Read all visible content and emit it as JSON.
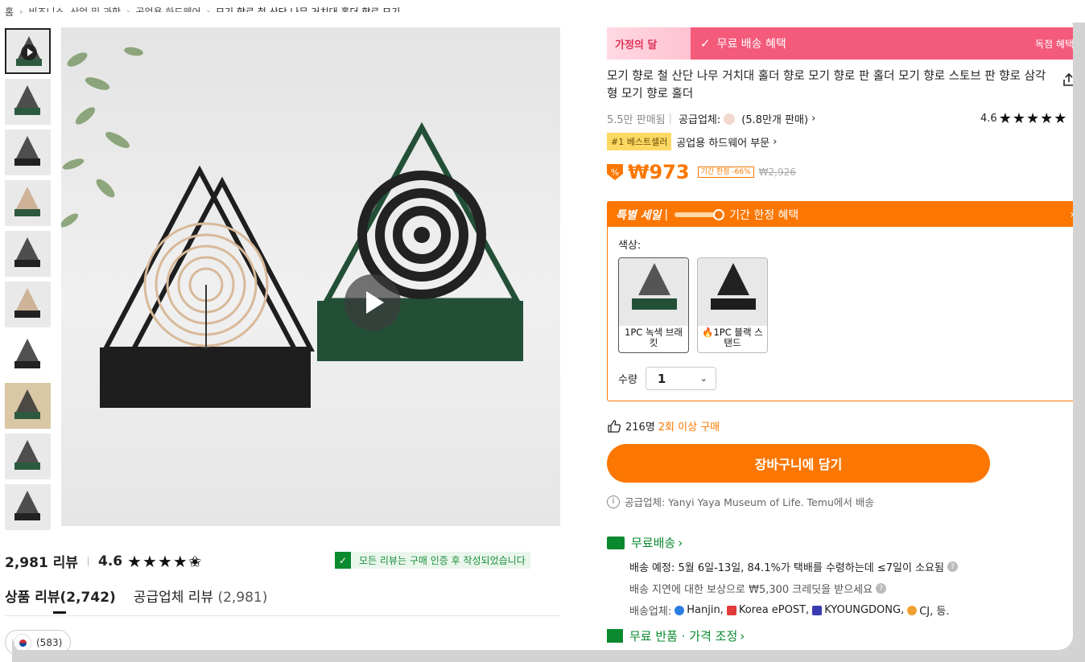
{
  "breadcrumb": {
    "items": [
      "홈",
      "비즈니스, 산업 및 과학",
      "공업용 하드웨어"
    ],
    "current": "모기 향로 철 산단 나무 거치대 홀더 향로 모기..."
  },
  "gallery": {
    "thumbnail_count": 10
  },
  "reviews": {
    "count": "2,981 리뷰",
    "rating": "4.6",
    "stars": "★★★★✬",
    "verified_text": "모든 리뷰는 구매 인증 후 작성되었습니다",
    "tabs": [
      {
        "label": "상품 리뷰",
        "count": "(2,742)"
      },
      {
        "label": "공급업체 리뷰",
        "count": "(2,981)"
      }
    ],
    "country_count": "(583)"
  },
  "promo": {
    "festival": "가정의 달",
    "label": "무료 배송 혜택",
    "right_label": "독점 혜택",
    "color": "#f45a7a"
  },
  "product": {
    "title": "모기 향로 철 산단 나무 거치대 홀더 향로 모기 향로 판 홀더 모기 향로 스토브 판 향로 삼각형 모기 향로 홀더",
    "sold": "5.5만 판매됨",
    "supplier_label": "공급업체:",
    "supplier_sales": "(5.8만개 판매)",
    "rating": "4.6",
    "rating_stars": "★★★★★",
    "best_badge": "#1 베스트셀러",
    "best_category": "공업용 하드웨어 부문",
    "price": "₩973",
    "limited_tag": "기간 한정 -66%",
    "original_price": "₩2,926",
    "accent_color": "#fb7701"
  },
  "sale": {
    "special": "특별 세일",
    "limited": "기간 한정 혜택",
    "color_label": "색상:",
    "options": [
      {
        "label": "1PC 녹색 브래킷",
        "fire": ""
      },
      {
        "label": "1PC 블랙 스탠드",
        "fire": "🔥"
      }
    ],
    "qty_label": "수량",
    "qty_value": "1"
  },
  "buyers": {
    "count": "216명",
    "highlight": "2회 이상 구매"
  },
  "cart_button": "장바구니에 담기",
  "supplier_note": "공급업체: Yanyi Yaya Museum of Life. Temu에서 배송",
  "shipping": {
    "title": "무료배송",
    "eta": "배송 예정: 5월 6일-13일, 84.1%가 택배를 수령하는데 ≤7일이 소요됨",
    "compensation": "배송 지연에 대한 보상으로 ₩5,300 크레딧을 받으세요",
    "carriers_label": "배송업체:",
    "carriers": [
      "Hanjin,",
      "Korea ePOST,",
      "KYOUNGDONG,",
      "CJ, 등."
    ]
  },
  "returns": {
    "title": "무료 반품 · 가격 조정"
  }
}
